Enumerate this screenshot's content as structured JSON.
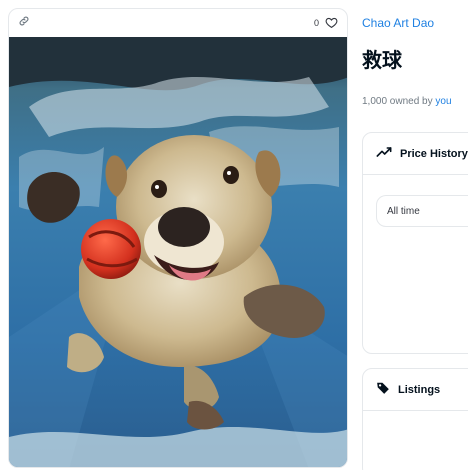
{
  "media": {
    "favorite_count": "0",
    "icons": {
      "link": "link-icon",
      "favorite": "heart-icon"
    }
  },
  "item": {
    "collection_name": "Chao Art Dao",
    "title": "救球",
    "owned_count": "1,000 owned by",
    "owner": "you"
  },
  "price_history": {
    "heading": "Price History",
    "icon": "trend-line-icon",
    "range_value": "All time"
  },
  "listings": {
    "heading": "Listings",
    "icon": "tag-icon"
  },
  "colors": {
    "link_blue": "#2081e2",
    "border": "#e5e8eb",
    "text_primary": "#04111d",
    "text_secondary": "#707a83"
  }
}
